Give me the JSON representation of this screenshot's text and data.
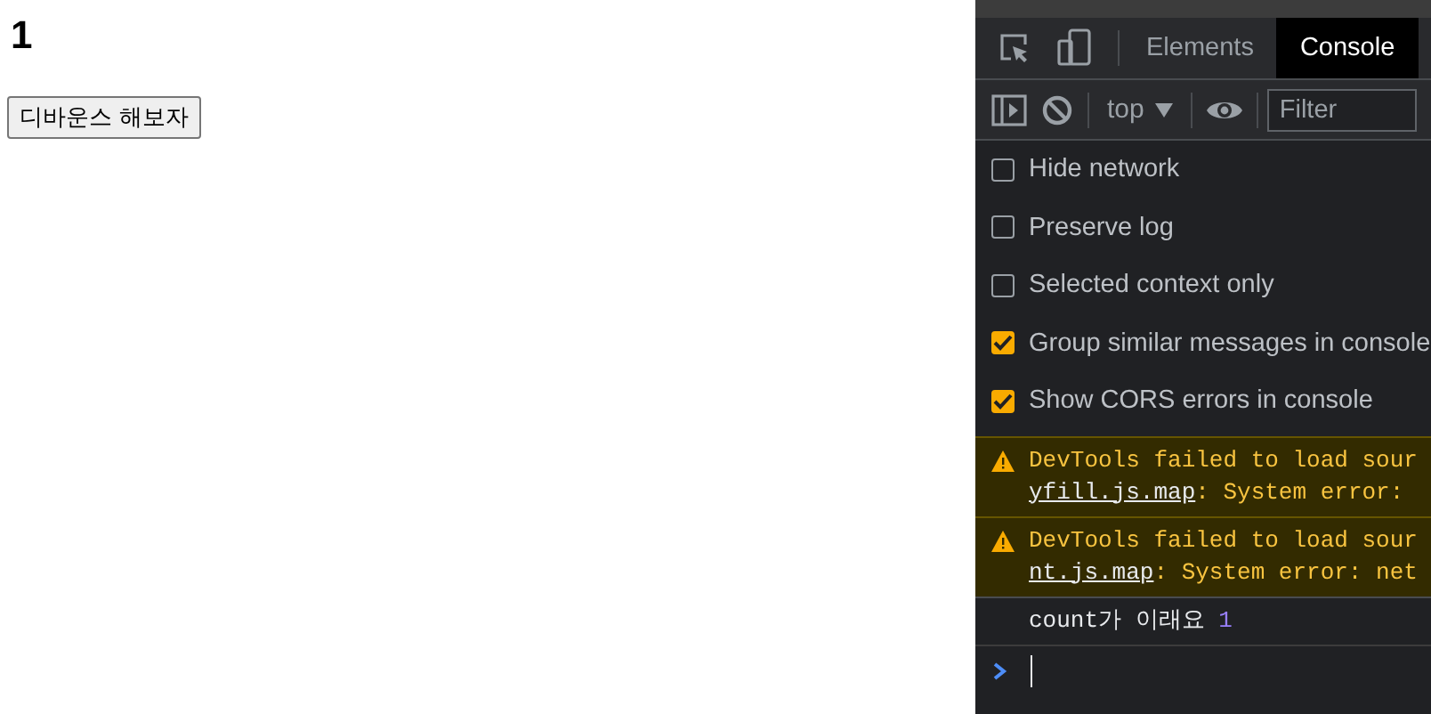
{
  "page": {
    "heading": "1",
    "button": "디바운스 해보자"
  },
  "devtools": {
    "tabs": [
      {
        "label": "Elements",
        "selected": false
      },
      {
        "label": "Console",
        "selected": true
      }
    ],
    "toolbar": {
      "context": "top",
      "filter": {
        "placeholder": "Filter"
      }
    },
    "settings": [
      {
        "label": "Hide network",
        "checked": false
      },
      {
        "label": "Preserve log",
        "checked": false
      },
      {
        "label": "Selected context only",
        "checked": false
      },
      {
        "label": "Group similar messages in console",
        "checked": true
      },
      {
        "label": "Show CORS errors in console",
        "checked": true
      }
    ],
    "messages": [
      {
        "kind": "warning",
        "text": "DevTools failed to load sour",
        "link": "yfill.js.map",
        "rest": ": System error: "
      },
      {
        "kind": "warning",
        "text": "DevTools failed to load sour",
        "link": "nt.js.map",
        "rest": ": System error: net"
      },
      {
        "kind": "log",
        "text": "count가 이래요",
        "value": "1"
      }
    ]
  }
}
